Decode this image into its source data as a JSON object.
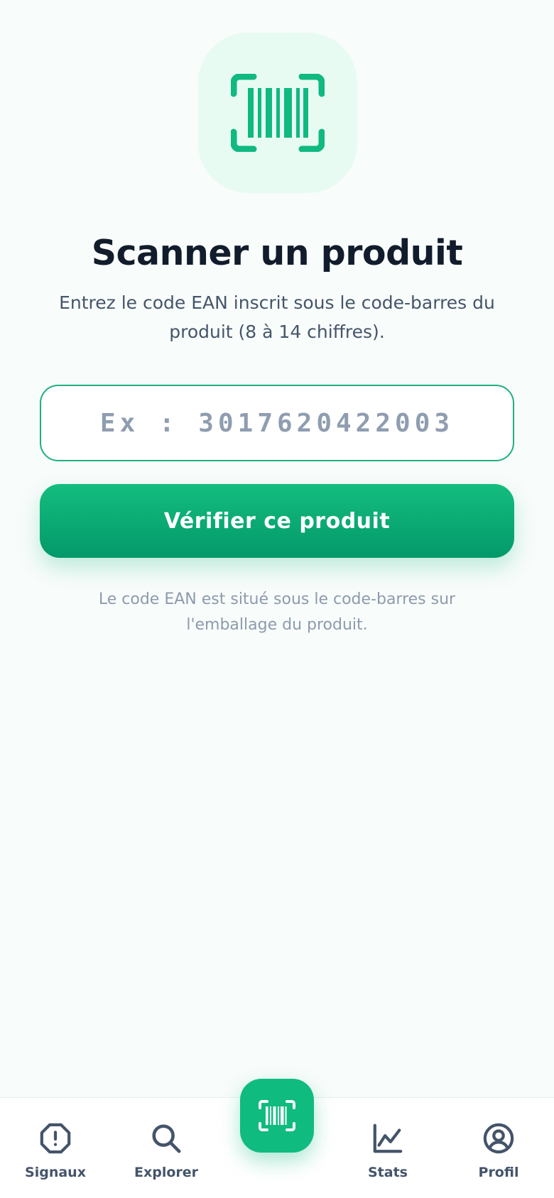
{
  "colors": {
    "accent": "#10b981",
    "accent_dark": "#059669",
    "icon_bg": "#e8fbf2",
    "text_primary": "#111c2c",
    "text_secondary": "#45556a",
    "text_muted": "#8d9bad",
    "nav_text": "#44546a"
  },
  "hero": {
    "icon": "barcode-scan-icon"
  },
  "main": {
    "title": "Scanner un produit",
    "subtitle": "Entrez le code EAN inscrit sous le code-barres du produit (8 à 14 chiffres).",
    "input": {
      "value": "",
      "placeholder": "Ex : 3017620422003"
    },
    "verify_button_label": "Vérifier ce produit",
    "hint": "Le code EAN est situé sous le code-barres sur l'emballage du produit."
  },
  "bottom_nav": {
    "items": [
      {
        "label": "Signaux",
        "icon": "alert-octagon-icon"
      },
      {
        "label": "Explorer",
        "icon": "search-icon"
      },
      {
        "label": "",
        "icon": "barcode-scan-icon"
      },
      {
        "label": "Stats",
        "icon": "trend-chart-icon"
      },
      {
        "label": "Profil",
        "icon": "user-circle-icon"
      }
    ]
  }
}
